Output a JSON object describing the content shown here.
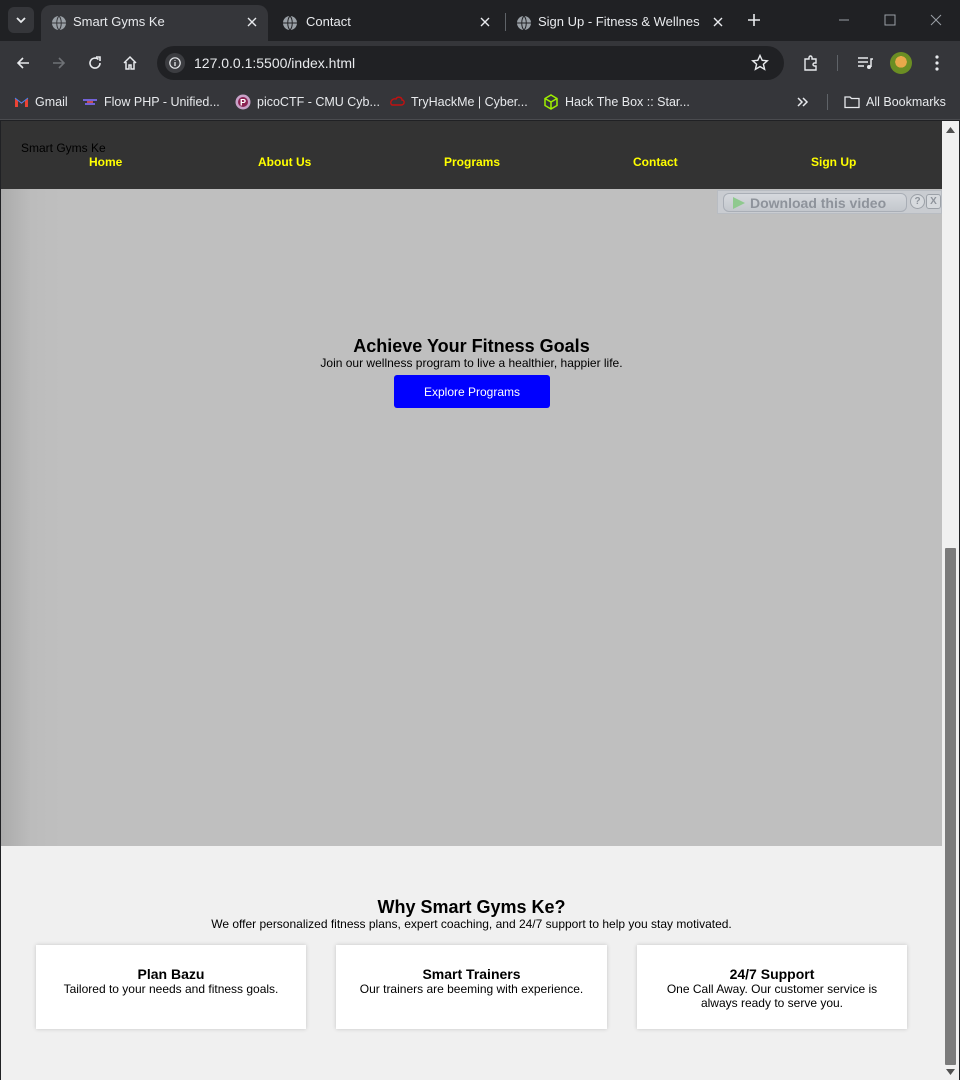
{
  "browser": {
    "tabs": [
      {
        "title": "Smart Gyms Ke",
        "active": true
      },
      {
        "title": "Contact",
        "active": false
      },
      {
        "title": "Sign Up - Fitness & Wellness C",
        "active": false
      }
    ],
    "url": "127.0.0.1:5500/index.html",
    "bookmarks": [
      {
        "label": "Gmail",
        "icon": "gmail-icon"
      },
      {
        "label": "Flow PHP - Unified...",
        "icon": "flow-php-icon"
      },
      {
        "label": "picoCTF - CMU Cyb...",
        "icon": "picoctf-icon"
      },
      {
        "label": "TryHackMe | Cyber...",
        "icon": "tryhackme-icon"
      },
      {
        "label": "Hack The Box :: Star...",
        "icon": "hackthebox-icon"
      }
    ],
    "all_bookmarks_label": "All Bookmarks"
  },
  "site": {
    "logo": "Smart Gyms Ke",
    "nav": [
      "Home",
      "About Us",
      "Programs",
      "Contact",
      "Sign Up"
    ],
    "nav_color": "#ffff00",
    "header_bg": "#333333"
  },
  "video_download": {
    "label": "Download this video",
    "help": "?",
    "close": "X"
  },
  "hero": {
    "title": "Achieve Your Fitness Goals",
    "subtitle": "Join our wellness program to live a healthier, happier life.",
    "cta": "Explore Programs",
    "cta_color": "#0000ff"
  },
  "features": {
    "title": "Why Smart Gyms Ke?",
    "intro": "We offer personalized fitness plans, expert coaching, and 24/7 support to help you stay motivated.",
    "cards": [
      {
        "title": "Plan Bazu",
        "text": "Tailored to your needs and fitness goals."
      },
      {
        "title": "Smart Trainers",
        "text": "Our trainers are beeming with experience."
      },
      {
        "title": "24/7 Support",
        "text": "One Call Away. Our customer service is always ready to serve you."
      }
    ]
  }
}
